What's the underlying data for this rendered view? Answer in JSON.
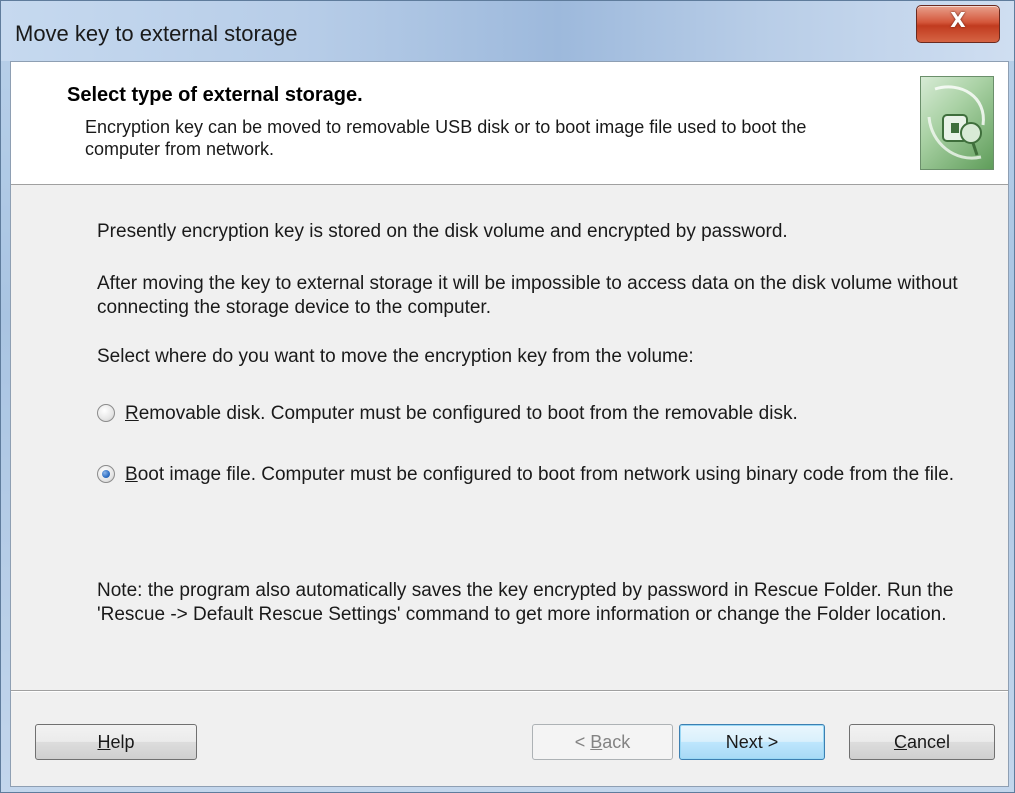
{
  "window": {
    "title": "Move key to external storage",
    "close_glyph": "X"
  },
  "header": {
    "title": "Select type of external storage.",
    "description": "Encryption key can be moved to removable USB disk or to boot image file used to boot the computer from network.",
    "image_icon": "key-drive-icon"
  },
  "body": {
    "para1": "Presently encryption key is stored on the disk volume and encrypted by password.",
    "para2": "After moving the key to external storage it will be impossible to access data on the disk volume without connecting the storage device to the computer.",
    "prompt": "Select where do you want to move the encryption key from the volume:",
    "options": [
      {
        "mnemonic": "R",
        "rest": "emovable disk. Computer must be configured to boot from the removable disk.",
        "selected": false
      },
      {
        "mnemonic": "B",
        "rest": "oot image file. Computer must be configured to boot from network using binary code from the file.",
        "selected": true
      }
    ],
    "note": "Note: the program also automatically saves the key encrypted by password in Rescue Folder. Run the 'Rescue -> Default Rescue Settings' command to get more information or change the Folder location."
  },
  "buttons": {
    "help": {
      "mnemonic": "H",
      "rest": "elp"
    },
    "back": {
      "prefix": "< ",
      "mnemonic": "B",
      "rest": "ack",
      "enabled": false
    },
    "next": {
      "label": "Next >"
    },
    "cancel": {
      "mnemonic": "C",
      "rest": "ancel"
    }
  }
}
